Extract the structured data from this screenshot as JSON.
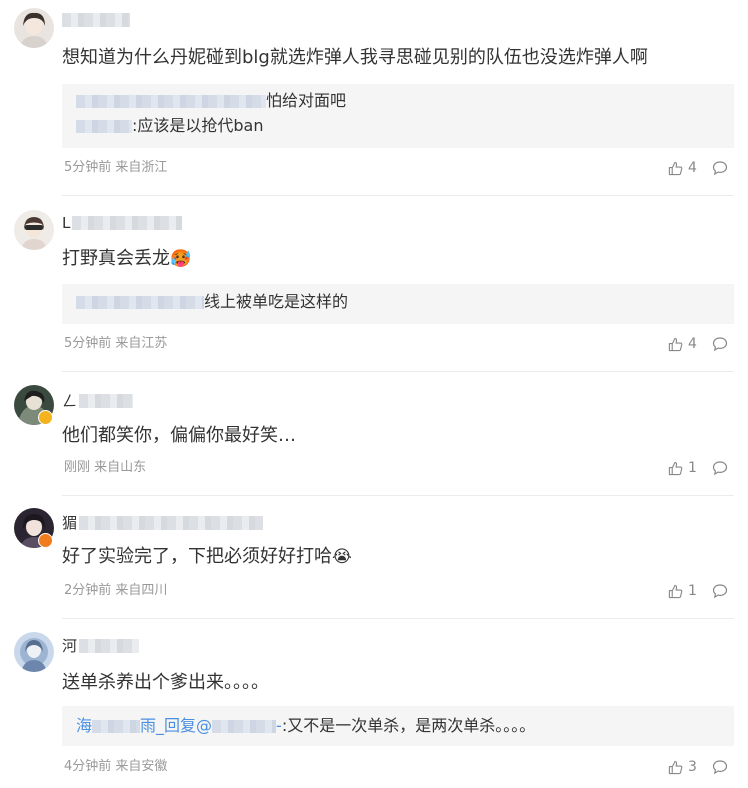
{
  "comments": [
    {
      "text": "想知道为什么丹妮碰到blg就选炸弹人我寻思碰见别的队伍也没选炸弹人啊",
      "replies": [
        {
          "text": "怕给对面吧"
        },
        {
          "text": ":应该是以抢代ban"
        }
      ],
      "time": "5分钟前",
      "location": "来自浙江",
      "likes": "4"
    },
    {
      "name_prefix": "L",
      "text": "打野真会丢龙",
      "emoji": "🥵",
      "replies": [
        {
          "text": "线上被单吃是这样的"
        }
      ],
      "time": "5分钟前",
      "location": "来自江苏",
      "likes": "4"
    },
    {
      "name_prefix": "ㄥ",
      "text": "他们都笑你，偏偏你最好笑…",
      "time": "刚刚",
      "location": "来自山东",
      "likes": "1",
      "badge_color": "#f5b21f"
    },
    {
      "name_prefix": "猸",
      "text": "好了实验完了，下把必须好好打哈",
      "emoji": "😭",
      "time": "2分钟前",
      "location": "来自四川",
      "likes": "1",
      "badge_color": "#f07c1e"
    },
    {
      "name_prefix": "河",
      "text": "送单杀养出个爹出来。。。。",
      "replies": [
        {
          "prefix": "海",
          "mid": "雨_回复@",
          "suffix": "-",
          "text": ":又不是一次单杀，是两次单杀。。。。"
        }
      ],
      "time": "4分钟前",
      "location": "来自安徽",
      "likes": "3"
    }
  ],
  "icons": {
    "like": "thumbs-up-icon",
    "reply": "comment-bubble-icon"
  },
  "colors": {
    "link": "#4a90e2",
    "meta": "#999999",
    "reply_bg": "#f5f5f5"
  }
}
